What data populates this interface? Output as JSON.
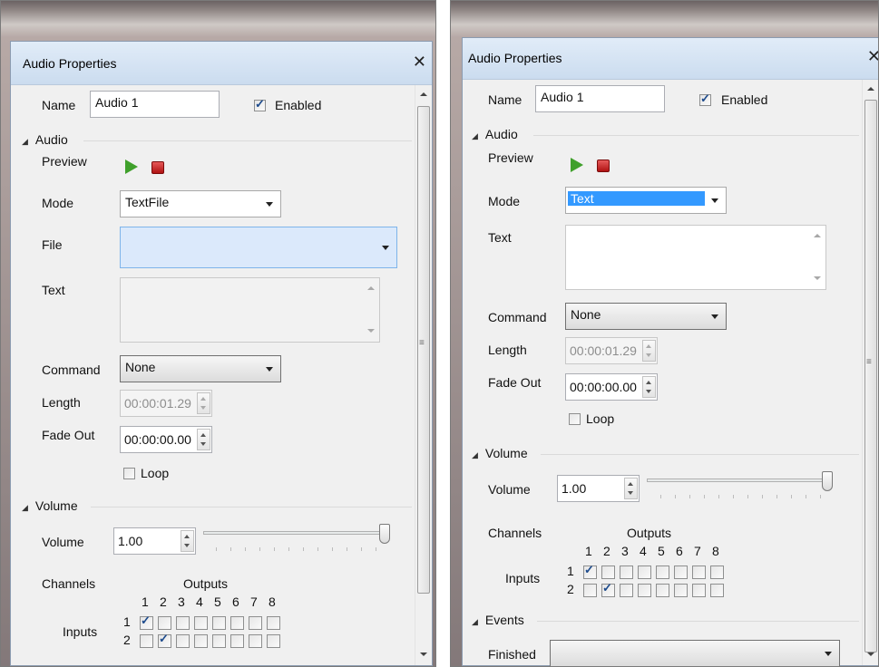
{
  "left": {
    "title": "Audio Properties",
    "close_icon": "close-icon",
    "name_label": "Name",
    "name_value": "Audio 1",
    "enabled_label": "Enabled",
    "enabled_checked": true,
    "audio_section": "Audio",
    "preview_label": "Preview",
    "mode_label": "Mode",
    "mode_value": "TextFile",
    "file_label": "File",
    "file_value": "",
    "text_label": "Text",
    "command_label": "Command",
    "command_value": "None",
    "length_label": "Length",
    "length_value": "00:00:01.29",
    "fadeout_label": "Fade Out",
    "fadeout_value": "00:00:00.00",
    "loop_label": "Loop",
    "volume_section": "Volume",
    "volume_label": "Volume",
    "volume_value": "1.00",
    "volume_slider_fraction": 1.0,
    "channels_label": "Channels",
    "outputs_label": "Outputs",
    "inputs_label": "Inputs",
    "output_numbers": [
      "1",
      "2",
      "3",
      "4",
      "5",
      "6",
      "7",
      "8"
    ],
    "input_numbers": [
      "1",
      "2"
    ],
    "matrix": [
      [
        1,
        0,
        0,
        0,
        0,
        0,
        0,
        0
      ],
      [
        0,
        1,
        0,
        0,
        0,
        0,
        0,
        0
      ]
    ]
  },
  "right": {
    "title": "Audio Properties",
    "close_icon": "close-icon",
    "name_label": "Name",
    "name_value": "Audio 1",
    "enabled_label": "Enabled",
    "enabled_checked": true,
    "audio_section": "Audio",
    "preview_label": "Preview",
    "mode_label": "Mode",
    "mode_value": "Text",
    "text_label": "Text",
    "command_label": "Command",
    "command_value": "None",
    "length_label": "Length",
    "length_value": "00:00:01.29",
    "fadeout_label": "Fade Out",
    "fadeout_value": "00:00:00.00",
    "loop_label": "Loop",
    "volume_section": "Volume",
    "volume_label": "Volume",
    "volume_value": "1.00",
    "volume_slider_fraction": 1.0,
    "channels_label": "Channels",
    "outputs_label": "Outputs",
    "inputs_label": "Inputs",
    "output_numbers": [
      "1",
      "2",
      "3",
      "4",
      "5",
      "6",
      "7",
      "8"
    ],
    "input_numbers": [
      "1",
      "2"
    ],
    "matrix": [
      [
        1,
        0,
        0,
        0,
        0,
        0,
        0,
        0
      ],
      [
        0,
        1,
        0,
        0,
        0,
        0,
        0,
        0
      ]
    ],
    "events_section": "Events",
    "finished_label": "Finished",
    "finished_value": ""
  }
}
